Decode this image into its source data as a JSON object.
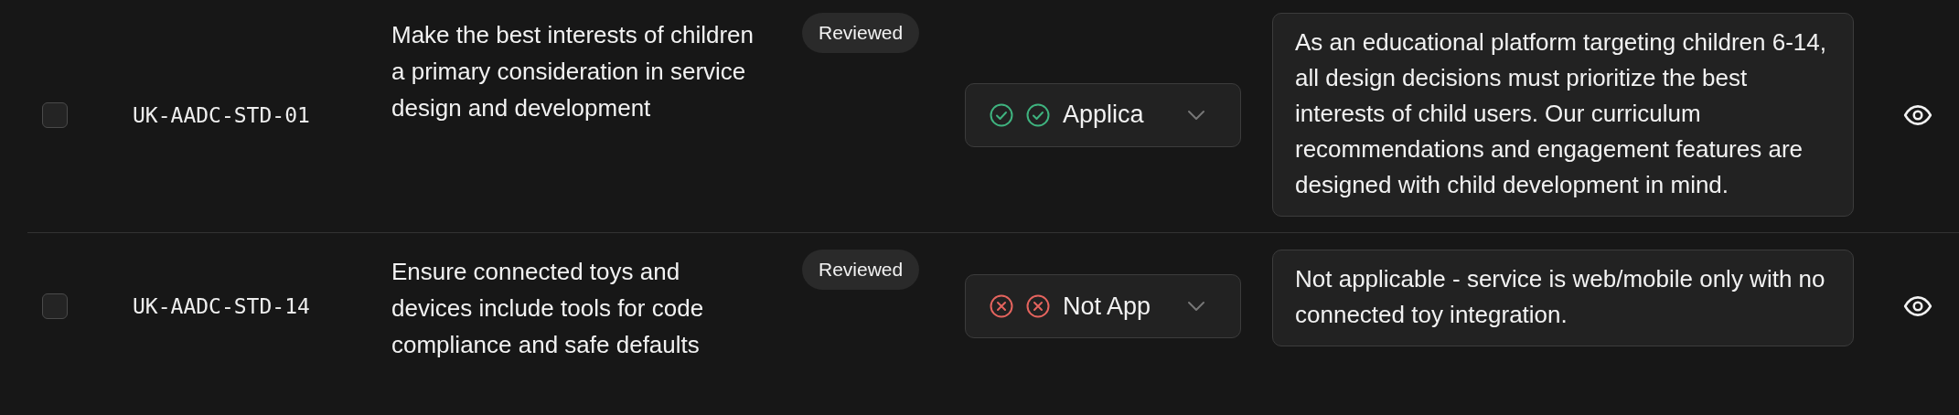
{
  "rows": [
    {
      "checked": false,
      "id": "UK-AADC-STD-01",
      "requirement": "Make the best interests of children a primary consideration in service design and development",
      "badge": "Reviewed",
      "status": {
        "kind": "applicable",
        "label": "Applica",
        "color": "#3fb37f"
      },
      "notes": "As an educational platform targeting children 6-14, all design decisions must prioritize the best interests of child users. Our curriculum recommendations and engagement features are designed with child development in mind."
    },
    {
      "checked": false,
      "id": "UK-AADC-STD-14",
      "requirement": "Ensure connected toys and devices include tools for code compliance and safe defaults",
      "badge": "Reviewed",
      "status": {
        "kind": "not_applicable",
        "label": "Not App",
        "color": "#e5645e"
      },
      "notes": "Not applicable - service is web/mobile only with no connected toy integration."
    }
  ]
}
